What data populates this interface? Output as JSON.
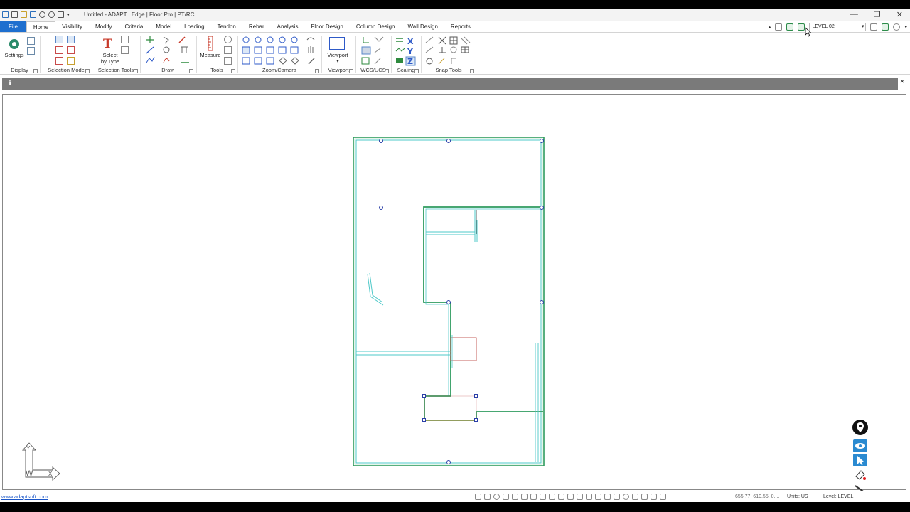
{
  "window": {
    "title": "Untitled - ADAPT | Edge | Floor Pro | PT/RC",
    "controls": {
      "minimize": "—",
      "maximize": "❐",
      "close": "✕"
    }
  },
  "menu": {
    "tabs": [
      {
        "label": "File"
      },
      {
        "label": "Home"
      },
      {
        "label": "Visibility"
      },
      {
        "label": "Modify"
      },
      {
        "label": "Criteria"
      },
      {
        "label": "Model"
      },
      {
        "label": "Loading"
      },
      {
        "label": "Tendon"
      },
      {
        "label": "Rebar"
      },
      {
        "label": "Analysis"
      },
      {
        "label": "Floor Design"
      },
      {
        "label": "Column Design"
      },
      {
        "label": "Wall Design"
      },
      {
        "label": "Reports"
      }
    ],
    "active_tab": "Home"
  },
  "level_selector": {
    "value": "LEVEL 02"
  },
  "ribbon": {
    "settings_label": "Settings",
    "select_by_type_label_1": "Select",
    "select_by_type_label_2": "by Type",
    "measure_label": "Measure",
    "viewport_label": "Viewport",
    "groups": {
      "display": "Display",
      "selection_mode": "Selection Mode",
      "selection_tools": "Selection Tools",
      "draw": "Draw",
      "tools": "Tools",
      "zoom_camera": "Zoom/Camera",
      "viewport": "Viewport",
      "wcs_ucs": "WCS/UCS",
      "scaling": "Scaling",
      "snap_tools": "Snap Tools"
    }
  },
  "infobar": {
    "icon": "i",
    "close": "×"
  },
  "ucs_icon": {
    "y": "Y",
    "w": "W",
    "x": "X"
  },
  "status": {
    "link": "www.adaptsoft.com",
    "coords": "655.77, 610.55, 0....",
    "units": "Units: US",
    "level": "Level: LEVEL"
  },
  "colors": {
    "file_tab": "#1e6fcf",
    "wall_green": "#2e9b5e",
    "wall_teal": "#4cc8c8",
    "slab_red": "#c0504d",
    "node_blue": "#2b3fa8"
  }
}
